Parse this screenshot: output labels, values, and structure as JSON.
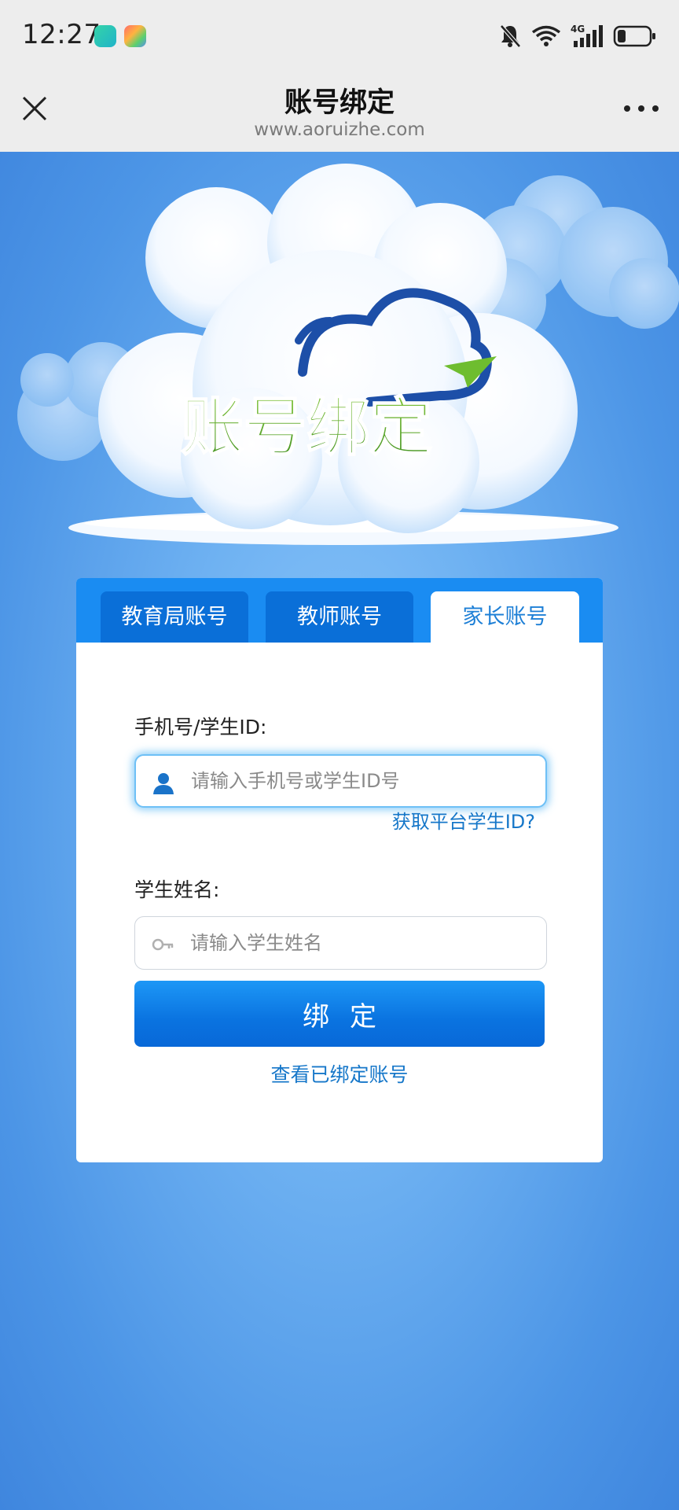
{
  "status_bar": {
    "time": "12:27",
    "network": "4G",
    "icons": [
      "app-icon-green",
      "app-icon-colorful",
      "bell-muted-icon",
      "wifi-icon",
      "signal-icon",
      "battery-icon"
    ]
  },
  "nav": {
    "title": "账号绑定",
    "url": "www.aoruizhe.com",
    "close_icon": "close-icon",
    "more_icon": "more-icon"
  },
  "banner": {
    "logo_text": "账号绑定"
  },
  "tabs": [
    {
      "label": "教育局账号",
      "active": false
    },
    {
      "label": "教师账号",
      "active": false
    },
    {
      "label": "家长账号",
      "active": true
    }
  ],
  "form": {
    "phone_label": "手机号/学生ID:",
    "phone_placeholder": "请输入手机号或学生ID号",
    "phone_value": "",
    "help_link": "获取平台学生ID?",
    "name_label": "学生姓名:",
    "name_placeholder": "请输入学生姓名",
    "name_value": "",
    "bind_button": "绑定",
    "view_bound_link": "查看已绑定账号"
  },
  "colors": {
    "accent": "#1a8cf2",
    "tab_inactive": "#0a6fd8",
    "link": "#1677c9",
    "logo_green": "#5aa52a",
    "logo_blue": "#1d4fa8"
  }
}
